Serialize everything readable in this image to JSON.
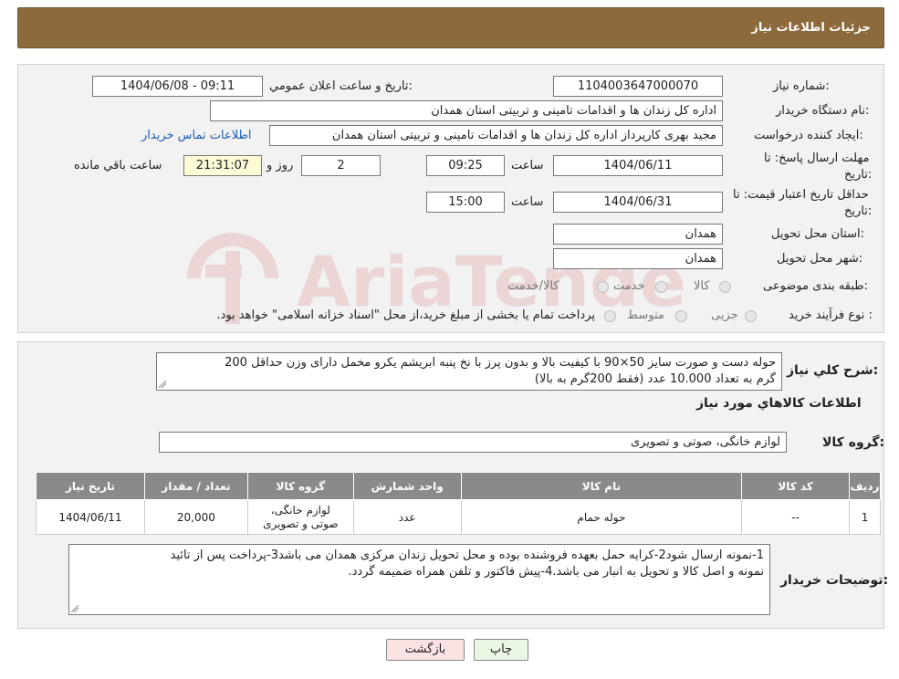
{
  "header": {
    "title": "جزئیات اطلاعات نیاز"
  },
  "need_number": {
    "label": "شماره نیاز:",
    "value": "1104003647000070"
  },
  "announce_datetime": {
    "label": "تاریخ و ساعت اعلان عمومي:",
    "value": "1404/06/08 - 09:11"
  },
  "buyer_org": {
    "label": "نام دستگاه خریدار:",
    "value": "اداره کل زندان ها و اقدامات تامینی و تربیتی استان همدان"
  },
  "requester": {
    "label": "ایجاد کننده درخواست:",
    "value": "مجید بهری کارپرداز اداره کل زندان ها و اقدامات تامینی و تربیتی استان همدان",
    "contact_link": "اطلاعات تماس خریدار"
  },
  "deadline": {
    "label_line1": "مهلت ارسال پاسخ: تا",
    "label_line2": "تاریخ:",
    "date": "1404/06/11",
    "time_label": "ساعت",
    "time": "09:25",
    "days": "2",
    "days_label": "روز و",
    "remaining": "21:31:07",
    "remaining_label": "ساعت باقي مانده"
  },
  "validity": {
    "label_line1": "حداقل تاریخ اعتبار قیمت: تا",
    "label_line2": "تاریخ:",
    "date": "1404/06/31",
    "time_label": "ساعت",
    "time": "15:00"
  },
  "province": {
    "label": "استان محل تحویل:",
    "value": "همدان"
  },
  "city": {
    "label": "شهر محل تحویل:",
    "value": "همدان"
  },
  "category": {
    "label": "طبقه بندی موضوعی:",
    "options": [
      "کالا",
      "خدمت",
      "کالا/خدمت"
    ]
  },
  "purchase_type": {
    "label": "نوع فرآیند خرید :",
    "options": [
      "جزیی",
      "متوسط"
    ],
    "note": "پرداخت تمام یا بخشی از مبلغ خرید،از محل \"اسناد خزانه اسلامی\" خواهد بود."
  },
  "watermark": {
    "text": "AriaTender.neT"
  },
  "summary": {
    "label": "شرح كلي نياز:",
    "line1": "حوله دست و صورت سایز 50×90 با کیفیت بالا و بدون پرز با نخ پنبه ابریشم یکرو مخمل دارای وزن حداقل 200",
    "line2": "گرم به تعداد 10.000 عدد (فقط 200گرم به بالا)"
  },
  "goods_info": {
    "title": "اطلاعات كالاهاي مورد نياز"
  },
  "goods_group": {
    "label": "گروه كالا:",
    "value": "لوازم خانگی، صوتی و تصویری"
  },
  "table": {
    "headers": [
      "رديف",
      "كد كالا",
      "نام كالا",
      "واحد شمارش",
      "گروه كالا",
      "تعداد / مقدار",
      "تاريخ نياز"
    ],
    "rows": [
      {
        "row": "1",
        "code": "--",
        "name": "حوله حمام",
        "unit": "عدد",
        "group_line1": "لوازم خانگی،",
        "group_line2": "صوتی و تصویری",
        "qty": "20,000",
        "date": "1404/06/11"
      }
    ]
  },
  "buyer_notes": {
    "label": "توضیحات خریدار:",
    "line1": "1-نمونه ارسال شود2-کرایه حمل بعهده فروشنده بوده و محل تحویل زندان مرکزی همدان می باشد3-پرداخت پس از تائید",
    "line2": "نمونه و اصل کالا و تحویل به انبار می باشد.4-پیش فاکتور و تلفن همراه ضمیمه گردد."
  },
  "buttons": {
    "print": "چاپ",
    "back": "بازگشت"
  }
}
